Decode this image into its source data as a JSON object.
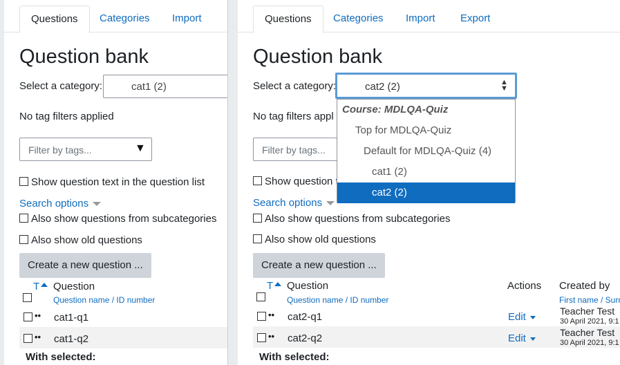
{
  "left": {
    "tabs": [
      "Questions",
      "Categories",
      "Import"
    ],
    "title": "Question bank",
    "select_category_label": "Select a category:",
    "selected_category": "cat1 (2)",
    "no_tag_filters": "No tag filters applied",
    "filter_placeholder": "Filter by tags...",
    "show_question_text": "Show question text in the question list",
    "search_options": "Search options",
    "also_subcategories": "Also show questions from subcategories",
    "also_old": "Also show old questions",
    "create_button": "Create a new question ...",
    "col_t": "T",
    "col_question": "Question",
    "col_question_sub": "Question name / ID number",
    "rows": [
      "cat1-q1",
      "cat1-q2"
    ],
    "with_selected": "With selected:"
  },
  "right": {
    "tabs": [
      "Questions",
      "Categories",
      "Import",
      "Export"
    ],
    "title": "Question bank",
    "select_category_label": "Select a category:",
    "selected_category": "cat2 (2)",
    "no_tag_filters": "No tag filters appl",
    "filter_placeholder": "Filter by tags...",
    "show_question_text": "Show question t",
    "search_options": "Search options",
    "also_subcategories": "Also show questions from subcategories",
    "also_old": "Also show old questions",
    "create_button": "Create a new question ...",
    "col_t": "T",
    "col_question": "Question",
    "col_question_sub": "Question name / ID number",
    "col_actions": "Actions",
    "col_created": "Created by",
    "col_created_sub": "First name / Surn",
    "rows": [
      {
        "name": "cat2-q1",
        "edit": "Edit",
        "creator": "Teacher Test",
        "date": "30 April 2021, 9:1"
      },
      {
        "name": "cat2-q2",
        "edit": "Edit",
        "creator": "Teacher Test",
        "date": "30 April 2021, 9:1"
      }
    ],
    "with_selected": "With selected:",
    "dropdown": {
      "group": "Course: MDLQA-Quiz",
      "options": [
        "Top for MDLQA-Quiz",
        "Default for MDLQA-Quiz (4)",
        "cat1 (2)",
        "cat2 (2)"
      ]
    }
  },
  "colors": {
    "accent": "#0f6cbf",
    "button_bg": "#ced4da"
  }
}
